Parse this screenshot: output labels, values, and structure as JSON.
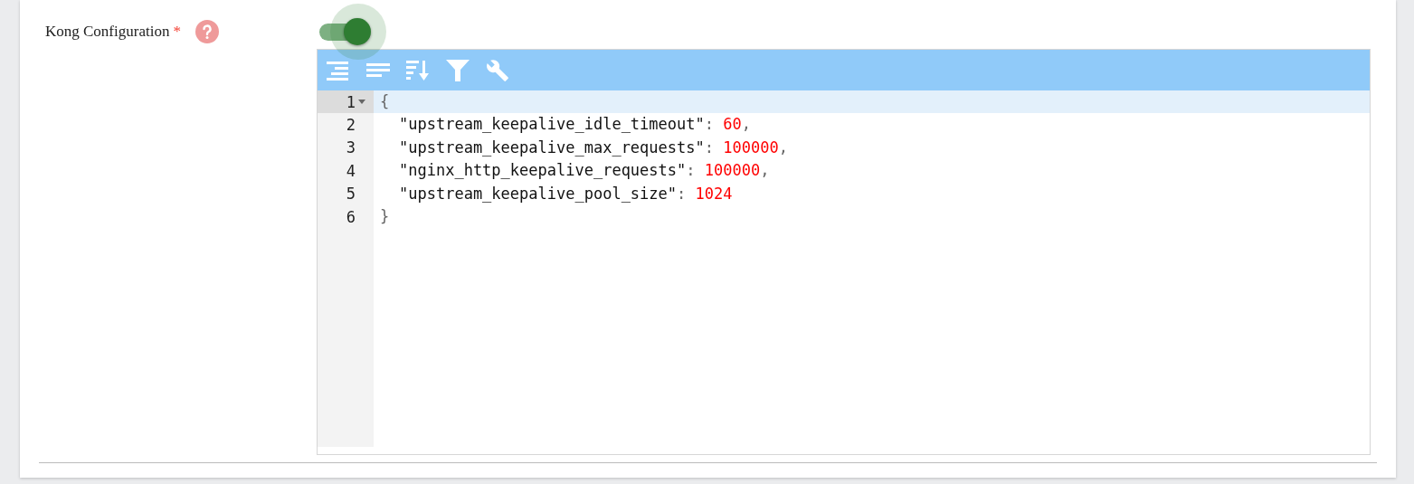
{
  "field": {
    "label": "Kong Configuration",
    "required_mark": "*",
    "toggle": {
      "on": true
    }
  },
  "editor": {
    "toolbar": [
      {
        "kind": "format"
      },
      {
        "kind": "compact"
      },
      {
        "kind": "sort"
      },
      {
        "kind": "filter"
      },
      {
        "kind": "repair"
      }
    ],
    "lines": [
      {
        "number": "1",
        "active": true,
        "foldable": true,
        "tokens": [
          {
            "kind": "punct",
            "text": "{"
          }
        ],
        "children": [
          {
            "number": "2",
            "active": false,
            "foldable": false,
            "tokens": [
              {
                "kind": "key",
                "text": "\"upstream_keepalive_idle_timeout\""
              },
              {
                "kind": "punct",
                "text": ": "
              },
              {
                "kind": "number",
                "text": "60"
              },
              {
                "kind": "punct",
                "text": ","
              }
            ]
          },
          {
            "number": "3",
            "active": false,
            "foldable": false,
            "tokens": [
              {
                "kind": "key",
                "text": "\"upstream_keepalive_max_requests\""
              },
              {
                "kind": "punct",
                "text": ": "
              },
              {
                "kind": "number",
                "text": "100000"
              },
              {
                "kind": "punct",
                "text": ","
              }
            ]
          },
          {
            "number": "4",
            "active": false,
            "foldable": false,
            "tokens": [
              {
                "kind": "key",
                "text": "\"nginx_http_keepalive_requests\""
              },
              {
                "kind": "punct",
                "text": ": "
              },
              {
                "kind": "number",
                "text": "100000"
              },
              {
                "kind": "punct",
                "text": ","
              }
            ]
          },
          {
            "number": "5",
            "active": false,
            "foldable": false,
            "tokens": [
              {
                "kind": "key",
                "text": "\"upstream_keepalive_pool_size\""
              },
              {
                "kind": "punct",
                "text": ": "
              },
              {
                "kind": "number",
                "text": "1024"
              }
            ]
          }
        ]
      },
      {
        "number": "6",
        "active": false,
        "foldable": false,
        "tokens": [
          {
            "kind": "punct",
            "text": "}"
          }
        ]
      }
    ]
  }
}
